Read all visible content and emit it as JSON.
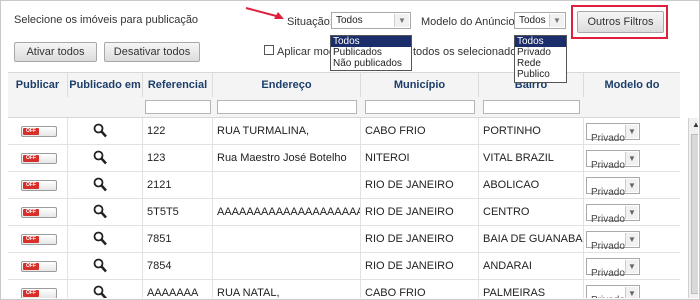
{
  "header": {
    "title": "Selecione os imóveis para publicação",
    "activate_all": "Ativar todos",
    "deactivate_all": "Desativar todos",
    "apply_checkbox_prefix": "Aplicar mode",
    "apply_checkbox_suffix": "todos os selecionados:",
    "situacao_label": "Situação:",
    "situacao_value": "Todos",
    "situacao_options": [
      "Todos",
      "Publicados",
      "Não publicados"
    ],
    "modelo_label": "Modelo do Anúncio:",
    "modelo_value": "Todos",
    "modelo_options": [
      "Todos",
      "Privado",
      "Rede",
      "Publico"
    ],
    "outros_filtros": "Outros Filtros",
    "highlight_color": "#e01f3d"
  },
  "table": {
    "columns": [
      "Publicar",
      "Publicado em",
      "Referencial",
      "Endereço",
      "Município",
      "Bairro",
      "Modelo do anúncio"
    ],
    "toggle_label": "OFF",
    "rows": [
      {
        "ref": "122",
        "endereco": "RUA TURMALINA,",
        "municipio": "CABO FRIO",
        "bairro": "PORTINHO",
        "modelo": "Privado"
      },
      {
        "ref": "123",
        "endereco": "Rua Maestro José Botelho",
        "municipio": "NITEROI",
        "bairro": "VITAL BRAZIL",
        "modelo": "Privado"
      },
      {
        "ref": "2121",
        "endereco": "",
        "municipio": "RIO DE JANEIRO",
        "bairro": "ABOLICAO",
        "modelo": "Privado"
      },
      {
        "ref": "5T5T5",
        "endereco": "AAAAAAAAAAAAAAAAAAAAAAAAAA",
        "municipio": "RIO DE JANEIRO",
        "bairro": "CENTRO",
        "modelo": "Privado"
      },
      {
        "ref": "7851",
        "endereco": "",
        "municipio": "RIO DE JANEIRO",
        "bairro": "BAIA DE GUANABARA",
        "modelo": "Privado"
      },
      {
        "ref": "7854",
        "endereco": "",
        "municipio": "RIO DE JANEIRO",
        "bairro": "ANDARAI",
        "modelo": "Privado"
      },
      {
        "ref": "AAAAAAA",
        "endereco": "RUA NATAL,",
        "municipio": "CABO FRIO",
        "bairro": "PALMEIRAS",
        "modelo": "Privado"
      }
    ]
  }
}
